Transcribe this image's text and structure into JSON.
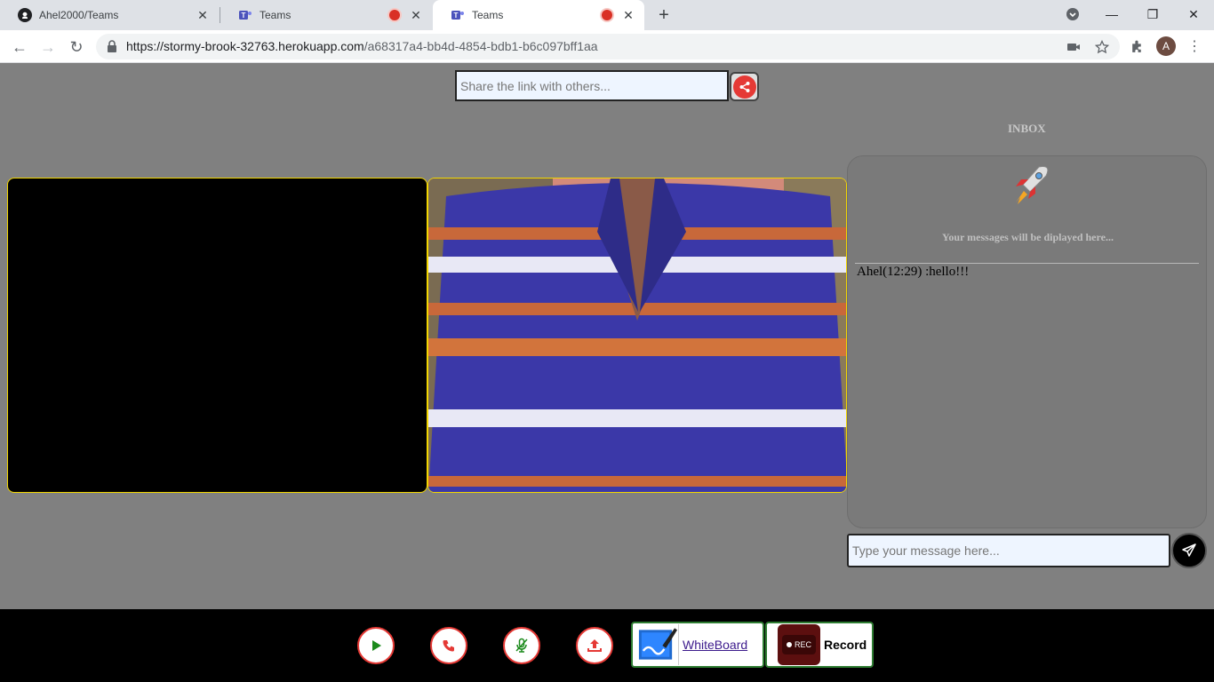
{
  "browser": {
    "tabs": [
      {
        "title": "Ahel2000/Teams",
        "icon": "github-icon"
      },
      {
        "title": "Teams",
        "icon": "teams-icon",
        "recording": true
      },
      {
        "title": "Teams",
        "icon": "teams-icon",
        "recording": true,
        "active": true
      }
    ],
    "url_host": "https://stormy-brook-32763.herokuapp.com",
    "url_path": "/a68317a4-bb4d-4854-bdb1-b6c097bff1aa",
    "profile_initial": "A"
  },
  "share": {
    "placeholder": "Share the link with others..."
  },
  "chat": {
    "title": "INBOX",
    "hint": "Your messages will be diplayed here...",
    "messages": [
      {
        "text": "Ahel(12:29) :hello!!!"
      }
    ],
    "input_placeholder": "Type your message here..."
  },
  "controls": {
    "whiteboard_label": "WhiteBoard",
    "record_label": "Record",
    "rec_badge": "REC"
  },
  "colors": {
    "page_bg": "#808080",
    "accent_red": "#e53935",
    "video_border": "#f2d600",
    "feature_border": "#2e7d32"
  }
}
